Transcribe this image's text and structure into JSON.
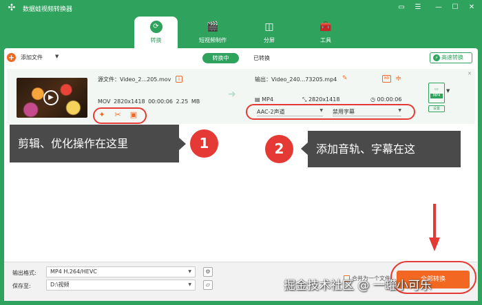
{
  "app": {
    "title": "数据蛙视频转换器"
  },
  "window_controls": [
    "▭",
    "☰",
    "—",
    "☐",
    "✕"
  ],
  "tabs": [
    {
      "label": "转换",
      "icon": "convert-icon"
    },
    {
      "label": "短视频制作",
      "icon": "clapper-icon"
    },
    {
      "label": "分屏",
      "icon": "split-screen-icon"
    },
    {
      "label": "工具",
      "icon": "toolbox-icon"
    }
  ],
  "toolbar": {
    "add_label": "添加文件",
    "seg_converting": "转换中",
    "seg_converted": "已转换",
    "fast_convert": "高速转换"
  },
  "file": {
    "source_name": "源文件：Video_2...205.mov",
    "meta": "MOV  2820x1418  00:00:06  2.25 MB",
    "output_name": "输出：Video_240...73205.mp4",
    "out_format": "MP4",
    "out_resolution": "2820x1418",
    "out_duration": "00:00:06",
    "audio_track": "AAC-2声道",
    "subtitle": "禁用字幕",
    "format_badge": "MP4",
    "settings_label": "设置"
  },
  "callouts": {
    "one_text": "剪辑、优化操作在这里",
    "one_num": "1",
    "two_text": "添加音轨、字幕在这",
    "two_num": "2"
  },
  "bottom": {
    "format_label": "输出格式:",
    "format_value": "MP4 H.264/HEVC",
    "save_label": "保存至:",
    "save_value": "D:\\视频",
    "merge_label": "合并为一个文件",
    "convert_all": "全部转换"
  },
  "watermark": "掘金技术社区 @ 一罐小可乐",
  "colors": {
    "brand": "#2fa25d",
    "accent": "#f26822",
    "annotation": "#e53935"
  }
}
